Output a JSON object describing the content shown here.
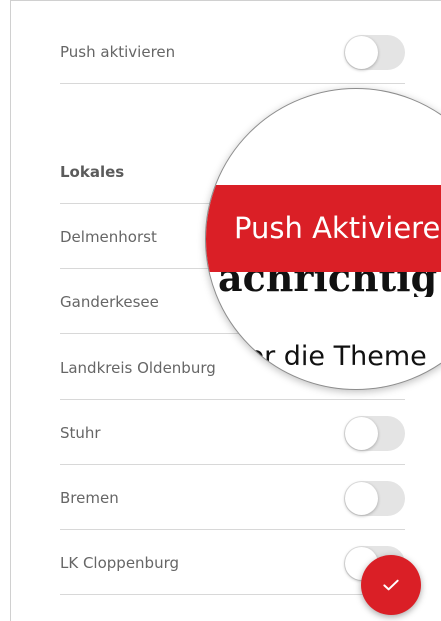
{
  "settings": {
    "push_row": {
      "label": "Push aktivieren",
      "enabled": false
    },
    "section": {
      "label": "Lokales"
    },
    "items": [
      {
        "label": "Delmenhorst",
        "enabled": false
      },
      {
        "label": "Ganderkesee",
        "enabled": false
      },
      {
        "label": "Landkreis Oldenburg",
        "enabled": false
      },
      {
        "label": "Stuhr",
        "enabled": false
      },
      {
        "label": "Bremen",
        "enabled": false
      },
      {
        "label": "LK Cloppenburg",
        "enabled": false
      }
    ]
  },
  "magnifier": {
    "bar_text": "Push Aktiviere",
    "heading_text": "achrichtig",
    "body_text": "ier die Theme",
    "body_text_2": "ichtigt"
  },
  "colors": {
    "accent": "#da1f26",
    "toggle_off": "#e4e4e4",
    "divider": "#d8d8d8",
    "label": "#666666"
  },
  "icons": {
    "fab": "checkmark-icon",
    "knob": "toggle-knob-icon"
  }
}
